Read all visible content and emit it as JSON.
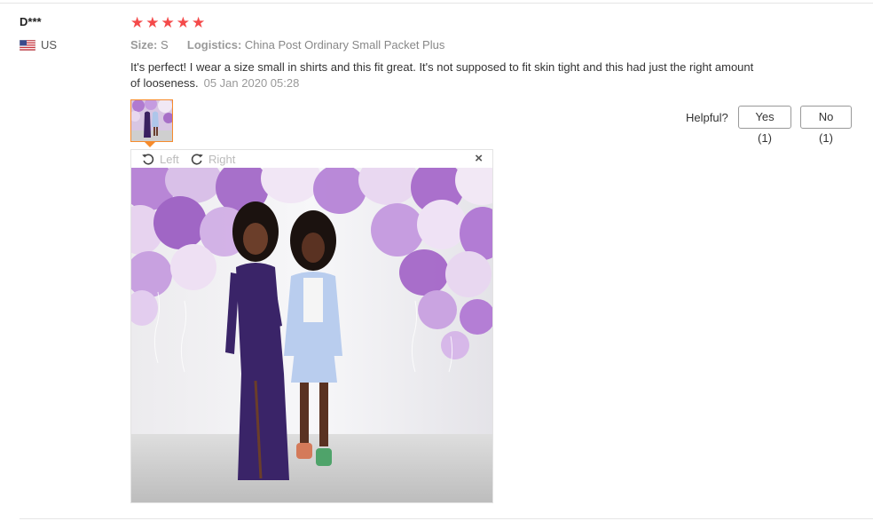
{
  "reviewer": {
    "name": "D***",
    "country": "US"
  },
  "rating": {
    "stars": 5,
    "max": 5
  },
  "attributes": {
    "size_label": "Size:",
    "size_value": "S",
    "logistics_label": "Logistics:",
    "logistics_value": "China Post Ordinary Small Packet Plus"
  },
  "review": {
    "text": "It's perfect! I wear a size small in shirts and this fit great. It's not supposed to fit skin tight and this had just the right amount of looseness.",
    "date": "05 Jan 2020 05:28"
  },
  "helpful": {
    "label": "Helpful?",
    "yes_label": "Yes (1)",
    "no_label": "No (1)"
  },
  "viewer": {
    "rotate_left_label": "Left",
    "rotate_right_label": "Right",
    "close_label": "×"
  },
  "colors": {
    "star": "#f44a4a",
    "thumb_border": "#f68b2c"
  }
}
